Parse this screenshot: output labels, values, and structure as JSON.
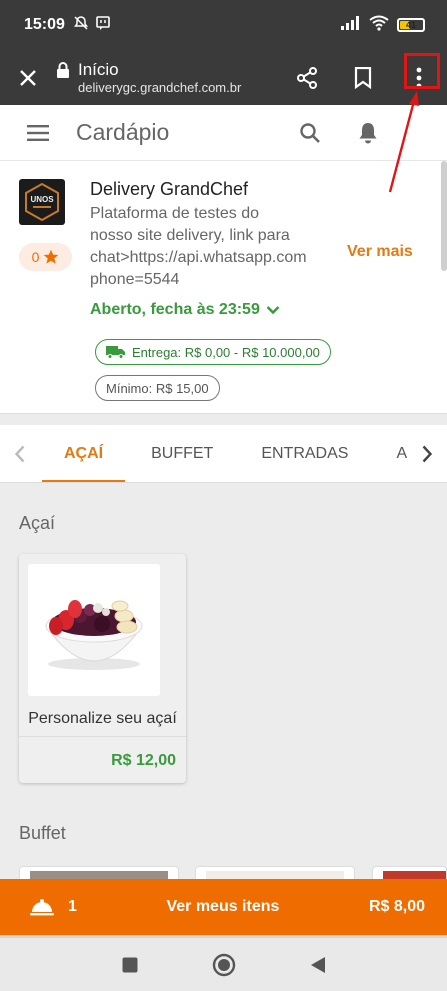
{
  "status_bar": {
    "time": "15:09",
    "battery_level": "41",
    "icons": [
      "mute-icon",
      "chat-icon",
      "signal-icon",
      "wifi-icon",
      "battery-icon"
    ]
  },
  "browser": {
    "title": "Início",
    "url": "deliverygc.grandchef.com.br",
    "actions": [
      "close-icon",
      "share-icon",
      "bookmark-icon",
      "more-vert-icon"
    ]
  },
  "app_header": {
    "title": "Cardápio"
  },
  "store": {
    "logo_text": "UNOS",
    "name": "Delivery GrandChef",
    "description": "Plataforma de testes do\nnosso site delivery, link para\nchat>https://api.whatsapp.com\nphone=5544",
    "rating": "0",
    "more_label": "Ver mais",
    "open_status": "Aberto, fecha às 23:59",
    "delivery_chip": "Entrega: R$ 0,00 - R$ 10.000,00",
    "minimum_chip": "Mínimo: R$ 15,00"
  },
  "categories": {
    "tabs": [
      "AÇAÍ",
      "BUFFET",
      "ENTRADAS",
      "A LA CA"
    ],
    "active": "AÇAÍ"
  },
  "sections": {
    "acai_title": "Açaí",
    "buffet_title": "Buffet"
  },
  "product": {
    "name": "Personalize seu açaí",
    "price": "R$ 12,00"
  },
  "order_bar": {
    "count": "1",
    "label": "Ver meus itens",
    "total": "R$ 8,00"
  },
  "colors": {
    "accent": "#ef6c00",
    "green": "#3a9a3e",
    "highlight": "#e01515"
  }
}
